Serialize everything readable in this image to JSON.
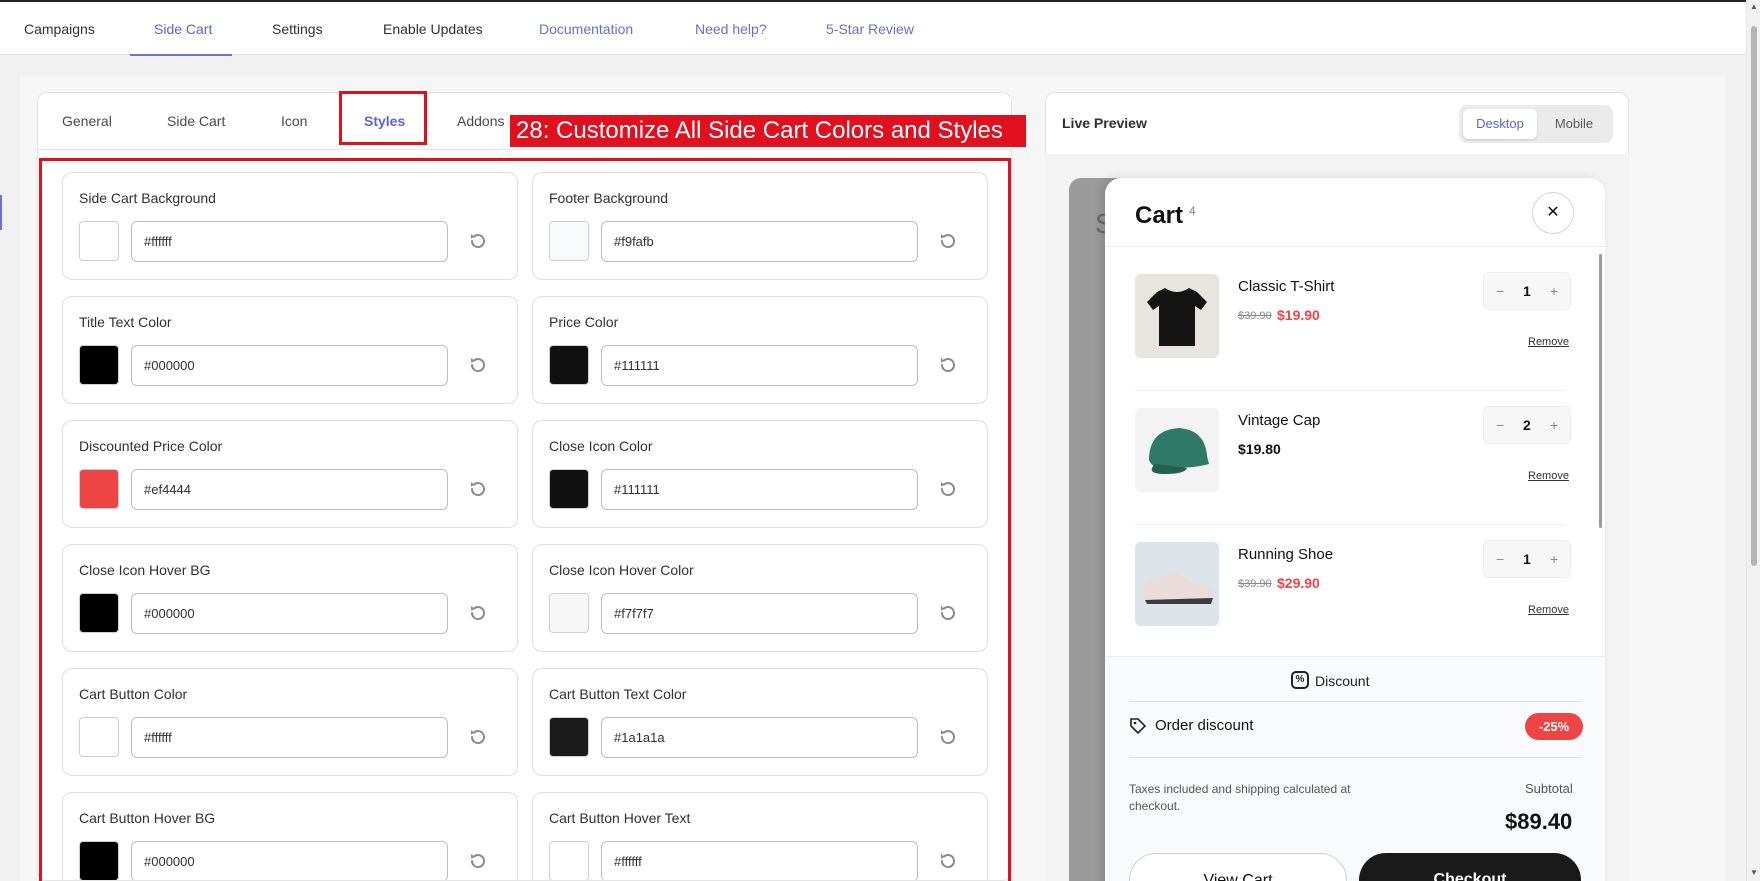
{
  "top_nav": {
    "items": [
      "Campaigns",
      "Side Cart",
      "Settings",
      "Enable Updates",
      "Documentation",
      "Need help?",
      "5-Star Review"
    ]
  },
  "subtabs": [
    "General",
    "Side Cart",
    "Icon",
    "Styles",
    "Addons"
  ],
  "annotation": "28: Customize All Side Cart Colors and Styles",
  "fields": [
    {
      "label": "Side Cart Background",
      "value": "#ffffff",
      "color": "#ffffff"
    },
    {
      "label": "Footer Background",
      "value": "#f9fafb",
      "color": "#f9fafb"
    },
    {
      "label": "Title Text Color",
      "value": "#000000",
      "color": "#000000"
    },
    {
      "label": "Price Color",
      "value": "#111111",
      "color": "#111111"
    },
    {
      "label": "Discounted Price Color",
      "value": "#ef4444",
      "color": "#ef4444"
    },
    {
      "label": "Close Icon Color",
      "value": "#111111",
      "color": "#111111"
    },
    {
      "label": "Close Icon Hover BG",
      "value": "#000000",
      "color": "#000000"
    },
    {
      "label": "Close Icon Hover Color",
      "value": "#f7f7f7",
      "color": "#f7f7f7"
    },
    {
      "label": "Cart Button Color",
      "value": "#ffffff",
      "color": "#ffffff"
    },
    {
      "label": "Cart Button Text Color",
      "value": "#1a1a1a",
      "color": "#1a1a1a"
    },
    {
      "label": "Cart Button Hover BG",
      "value": "#000000",
      "color": "#000000"
    },
    {
      "label": "Cart Button Hover Text",
      "value": "#ffffff",
      "color": "#ffffff"
    }
  ],
  "preview": {
    "title": "Live Preview",
    "toggle": {
      "desktop": "Desktop",
      "mobile": "Mobile"
    },
    "cart": {
      "title": "Cart",
      "count": "4",
      "items": [
        {
          "name": "Classic T-Shirt",
          "old_price": "$39.90",
          "price": "$19.90",
          "qty": "1",
          "remove": "Remove"
        },
        {
          "name": "Vintage Cap",
          "old_price": "",
          "price": "$19.80",
          "qty": "2",
          "remove": "Remove"
        },
        {
          "name": "Running Shoe",
          "old_price": "$39.90",
          "price": "$29.90",
          "qty": "1",
          "remove": "Remove"
        }
      ],
      "discount_heading": "Discount",
      "order_discount_label": "Order discount",
      "order_discount_badge": "-25%",
      "tax_note": "Taxes included and shipping calculated at checkout.",
      "subtotal_label": "Subtotal",
      "subtotal_value": "$89.40",
      "view_cart": "View Cart",
      "checkout": "Checkout"
    }
  }
}
